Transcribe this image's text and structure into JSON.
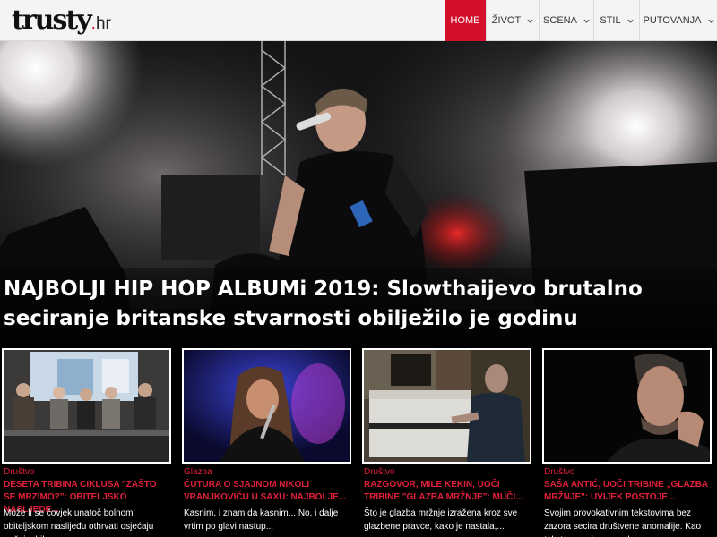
{
  "site": {
    "logo_word": "trusty",
    "logo_dot": ".",
    "logo_tld": "hr"
  },
  "nav": {
    "items": [
      {
        "label": "HOME",
        "active": true
      },
      {
        "label": "ŽIVOT"
      },
      {
        "label": "SCENA"
      },
      {
        "label": "STIL"
      },
      {
        "label": "PUTOVANJA"
      }
    ]
  },
  "hero": {
    "title": "NAJBOLJI HIP HOP ALBUMi 2019: Slowthaijevo brutalno seciranje britanske stvarnosti obilježilo je godinu"
  },
  "cards": [
    {
      "category": "Društvo",
      "title": "DESETA TRIBINA CIKLUSA \"ZAŠTO SE MRZIMO?\": OBITELJSKO NASLJEDE...",
      "excerpt": "Može li se čovjek unatoč bolnom obiteljskom naslijeđu othrvati osjećaju mržnje, bila..."
    },
    {
      "category": "Glazba",
      "title": "ĆUTURA O SJAJNOM NIKOLI VRANJKOVIĆU U SAXU: NAJBOLJE...",
      "excerpt": "Kasnim, i znam da kasnim... No, i dalje vrtim po glavi nastup..."
    },
    {
      "category": "Društvo",
      "title": "RAZGOVOR, MILE KEKIN, UOČI TRIBINE \"GLAZBA MRŽNJE\": MUČI...",
      "excerpt": "Što je glazba mržnje izražena kroz sve glazbene pravce, kako je nastala,..."
    },
    {
      "category": "Društvo",
      "title": "SAŠA ANTIĆ, UOČI TRIBINE „GLAZBA MRŽNJE\": UVIJEK POSTOJE...",
      "excerpt": "Svojim provokativnim tekstovima bez zazora secira društvene anomalije. Kao tekstopisac ima posebnu..."
    }
  ],
  "colors": {
    "accent": "#d2102c",
    "category_text": "#e0203a",
    "header_bg": "#f4f4f4"
  },
  "icons": {
    "nav_dropdown": "chevron-down-icon"
  }
}
